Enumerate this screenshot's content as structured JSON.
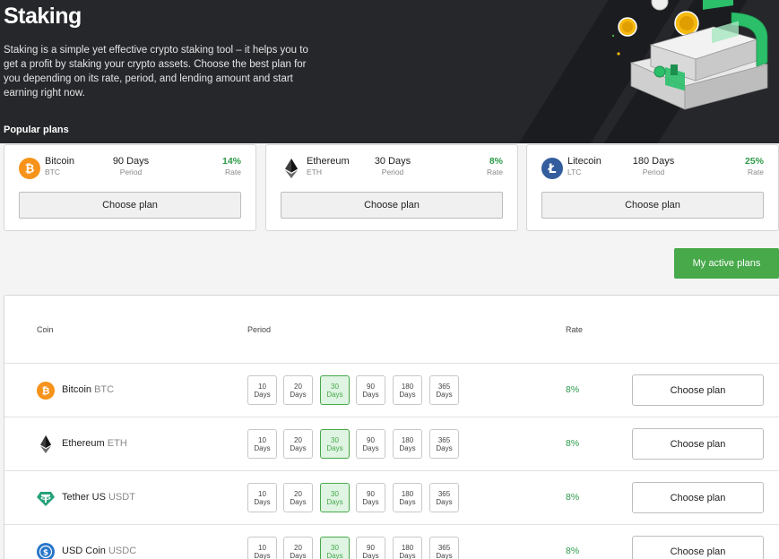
{
  "hero": {
    "title": "Staking",
    "description": "Staking is a simple yet effective crypto staking tool – it helps you to get a profit by staking your crypto assets. Choose the best plan for you depending on its rate, period, and lending amount and start earning right now.",
    "popular_label": "Popular plans"
  },
  "popular_plans": [
    {
      "name": "Bitcoin",
      "symbol": "BTC",
      "period": "90 Days",
      "period_label": "Period",
      "rate": "14%",
      "rate_label": "Rate",
      "button": "Choose plan",
      "icon": "bitcoin-icon",
      "color": "#f7931a"
    },
    {
      "name": "Ethereum",
      "symbol": "ETH",
      "period": "30 Days",
      "period_label": "Period",
      "rate": "8%",
      "rate_label": "Rate",
      "button": "Choose plan",
      "icon": "ethereum-icon",
      "color": "#3c3c3d"
    },
    {
      "name": "Litecoin",
      "symbol": "LTC",
      "period": "180 Days",
      "period_label": "Period",
      "rate": "25%",
      "rate_label": "Rate",
      "button": "Choose plan",
      "icon": "litecoin-icon",
      "color": "#345d9d"
    }
  ],
  "active_plans_button": "My active plans",
  "table": {
    "headers": {
      "coin": "Coin",
      "period": "Period",
      "rate": "Rate"
    },
    "period_options": [
      {
        "num": "10",
        "unit": "Days"
      },
      {
        "num": "20",
        "unit": "Days"
      },
      {
        "num": "30",
        "unit": "Days"
      },
      {
        "num": "90",
        "unit": "Days"
      },
      {
        "num": "180",
        "unit": "Days"
      },
      {
        "num": "365",
        "unit": "Days"
      }
    ],
    "selected_period_index": 2,
    "rows": [
      {
        "name": "Bitcoin",
        "symbol": "BTC",
        "rate": "8%",
        "button": "Choose plan",
        "icon": "bitcoin-icon"
      },
      {
        "name": "Ethereum",
        "symbol": "ETH",
        "rate": "8%",
        "button": "Choose plan",
        "icon": "ethereum-icon"
      },
      {
        "name": "Tether US",
        "symbol": "USDT",
        "rate": "8%",
        "button": "Choose plan",
        "icon": "tether-icon"
      },
      {
        "name": "USD Coin",
        "symbol": "USDC",
        "rate": "8%",
        "button": "Choose plan",
        "icon": "usd-coin-icon"
      }
    ]
  },
  "colors": {
    "accent_green": "#47a94a",
    "rate_green": "#2e9a4a",
    "hero_bg": "#26272b"
  }
}
